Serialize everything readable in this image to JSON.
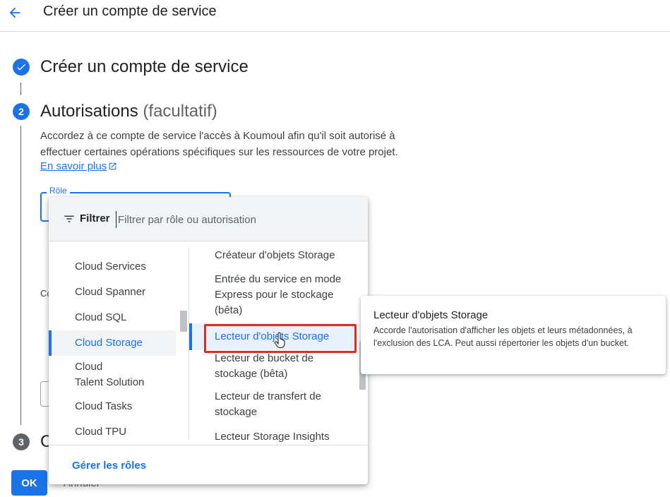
{
  "header": {
    "title": "Créer un compte de service"
  },
  "steps": {
    "step1": {
      "title": "Créer un compte de service"
    },
    "step2": {
      "number": "2",
      "title": "Autorisations",
      "optional": "(facultatif)",
      "description": "Accordez à ce compte de service l'accès à Koumoul afin qu'il soit autorisé à effectuer certaines opérations spécifiques sur les ressources de votre projet.",
      "learn_more": "En savoir plus"
    },
    "step3": {
      "number": "3",
      "title_first_char": "C",
      "title_end": ")"
    }
  },
  "role_field": {
    "label": "Rôle",
    "behind_text": "Co"
  },
  "buttons": {
    "ok": "OK",
    "cancel": "Annuler"
  },
  "dropdown": {
    "filter_label": "Filtrer",
    "filter_placeholder": "Filtrer par rôle ou autorisation",
    "services": [
      {
        "label": "Cloud Services",
        "selected": false
      },
      {
        "label": "Cloud Spanner",
        "selected": false
      },
      {
        "label": "Cloud SQL",
        "selected": false
      },
      {
        "label": "Cloud Storage",
        "selected": true
      },
      {
        "label": "Cloud\nTalent Solution",
        "selected": false
      },
      {
        "label": "Cloud Tasks",
        "selected": false
      },
      {
        "label": "Cloud TPU",
        "selected": false
      }
    ],
    "roles": [
      {
        "label": "Créateur d'objets Storage",
        "selected": false
      },
      {
        "label": "Entrée du service en mode Express pour le stockage (bêta)",
        "selected": false
      },
      {
        "label": "Lecteur d'objets Storage",
        "selected": true
      },
      {
        "label": "Lecteur de bucket de stockage (bêta)",
        "selected": false
      },
      {
        "label": "Lecteur de transfert de stockage",
        "selected": false
      },
      {
        "label": "Lecteur Storage Insights",
        "selected": false
      }
    ],
    "manage_roles": "Gérer les rôles"
  },
  "tooltip": {
    "title": "Lecteur d'objets Storage",
    "description": "Accorde l'autorisation d'afficher les objets et leurs métadonnées, à l'exclusion des LCA. Peut aussi répertorier les objets d'un bucket."
  },
  "colors": {
    "accent": "#1a73e8",
    "highlight": "#d93025"
  }
}
